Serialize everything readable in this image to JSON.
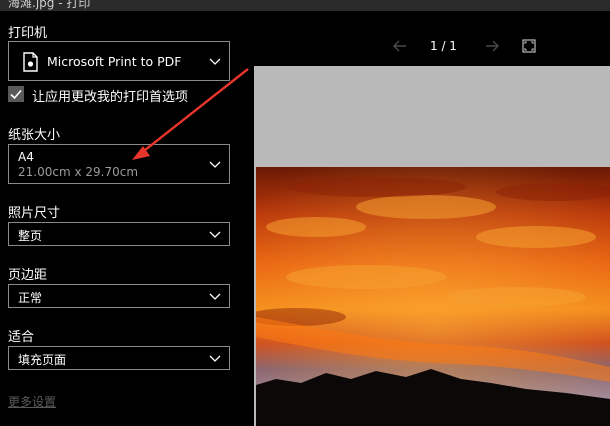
{
  "window": {
    "title": "海滩.jpg - 打印"
  },
  "printer": {
    "section_label": "打印机",
    "selected": "Microsoft Print to PDF"
  },
  "app_prefs": {
    "label": "让应用更改我的打印首选项",
    "checked": true
  },
  "paper_size": {
    "section_label": "纸张大小",
    "selected": "A4",
    "dimensions": "21.00cm x 29.70cm"
  },
  "photo_size": {
    "section_label": "照片尺寸",
    "selected": "整页"
  },
  "margins": {
    "section_label": "页边距",
    "selected": "正常"
  },
  "fit": {
    "section_label": "适合",
    "selected": "填充页面"
  },
  "more_settings": {
    "label": "更多设置"
  },
  "preview_nav": {
    "page_counter": "1 / 1"
  },
  "colors": {
    "accent_arrow": "#e8352b",
    "panel_bg": "#000000",
    "border": "#8a8a8a"
  },
  "icons": {
    "printer": "printer-icon",
    "chevron": "chevron-down-icon",
    "check": "check-icon",
    "prev": "arrow-left-icon",
    "next": "arrow-right-icon",
    "fit": "fit-page-icon"
  }
}
